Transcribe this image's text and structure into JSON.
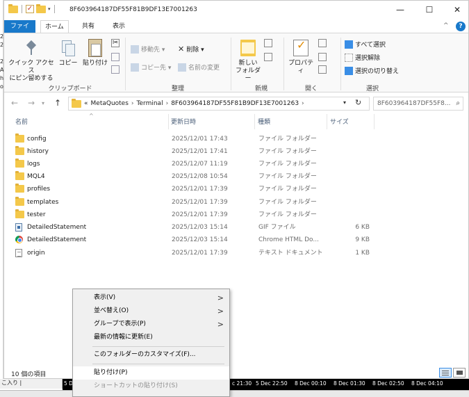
{
  "window": {
    "title": "8F603964187DF55F81B9DF13E7001263",
    "minimize": "—",
    "maximize": "☐",
    "close": "✕"
  },
  "behind_left_fragments": [
    "2",
    "2",
    "2",
    "A",
    "h",
    "o"
  ],
  "ribbon_tabs": [
    "ファイル",
    "ホーム",
    "共有",
    "表示"
  ],
  "ribbon": {
    "clipboard": {
      "pin": "クイック アクセス\nにピン留めする",
      "copy": "コピー",
      "paste": "貼り付け",
      "label": "クリップボード"
    },
    "organize": {
      "move_to": "移動先 ▾",
      "delete": "削除 ▾",
      "copy_to": "コピー先 ▾",
      "rename": "名前の変更",
      "label": "整理"
    },
    "new": {
      "new_folder": "新しい\nフォルダー",
      "label": "新規"
    },
    "open": {
      "properties": "プロパティ",
      "label": "開く"
    },
    "select": {
      "select_all": "すべて選択",
      "select_none": "選択解除",
      "invert": "選択の切り替え",
      "label": "選択"
    }
  },
  "address": {
    "overflow": "«",
    "crumbs": [
      "MetaQuotes",
      "Terminal",
      "8F603964187DF55F81B9DF13E7001263"
    ],
    "search_placeholder": "8F603964187DF55F8..."
  },
  "columns": {
    "name": "名前",
    "date": "更新日時",
    "type": "種類",
    "size": "サイズ"
  },
  "files": [
    {
      "name": "config",
      "date": "2025/12/01 17:43",
      "type": "ファイル フォルダー",
      "size": "",
      "icon": "folder"
    },
    {
      "name": "history",
      "date": "2025/12/01 17:41",
      "type": "ファイル フォルダー",
      "size": "",
      "icon": "folder"
    },
    {
      "name": "logs",
      "date": "2025/12/07 11:19",
      "type": "ファイル フォルダー",
      "size": "",
      "icon": "folder"
    },
    {
      "name": "MQL4",
      "date": "2025/12/08 10:54",
      "type": "ファイル フォルダー",
      "size": "",
      "icon": "folder"
    },
    {
      "name": "profiles",
      "date": "2025/12/01 17:39",
      "type": "ファイル フォルダー",
      "size": "",
      "icon": "folder"
    },
    {
      "name": "templates",
      "date": "2025/12/01 17:39",
      "type": "ファイル フォルダー",
      "size": "",
      "icon": "folder"
    },
    {
      "name": "tester",
      "date": "2025/12/01 17:39",
      "type": "ファイル フォルダー",
      "size": "",
      "icon": "folder"
    },
    {
      "name": "DetailedStatement",
      "date": "2025/12/03 15:14",
      "type": "GIF ファイル",
      "size": "6 KB",
      "icon": "gif"
    },
    {
      "name": "DetailedStatement",
      "date": "2025/12/03 15:14",
      "type": "Chrome HTML Do...",
      "size": "9 KB",
      "icon": "chrome"
    },
    {
      "name": "origin",
      "date": "2025/12/01 17:39",
      "type": "テキスト ドキュメント",
      "size": "1 KB",
      "icon": "text"
    }
  ],
  "status": {
    "item_count": "10 個の項目"
  },
  "context_menu": {
    "view": "表示(V)",
    "sort": "並べ替え(O)",
    "group": "グループで表示(P)",
    "refresh": "最新の情報に更新(E)",
    "customize": "このフォルダーのカスタマイズ(F)...",
    "paste": "貼り付け(P)",
    "paste_shortcut": "ショートカットの貼り付け(S)"
  },
  "bottom_strip": {
    "left_text": "こ入り |",
    "ticks": [
      "5 D",
      "c 21:30",
      "5 Dec 22:50",
      "8 Dec 00:10",
      "8 Dec 01:30",
      "8 Dec 02:50",
      "8 Dec 04:10"
    ]
  },
  "colors": {
    "accent": "#1979ca",
    "folder": "#f4c84a"
  }
}
